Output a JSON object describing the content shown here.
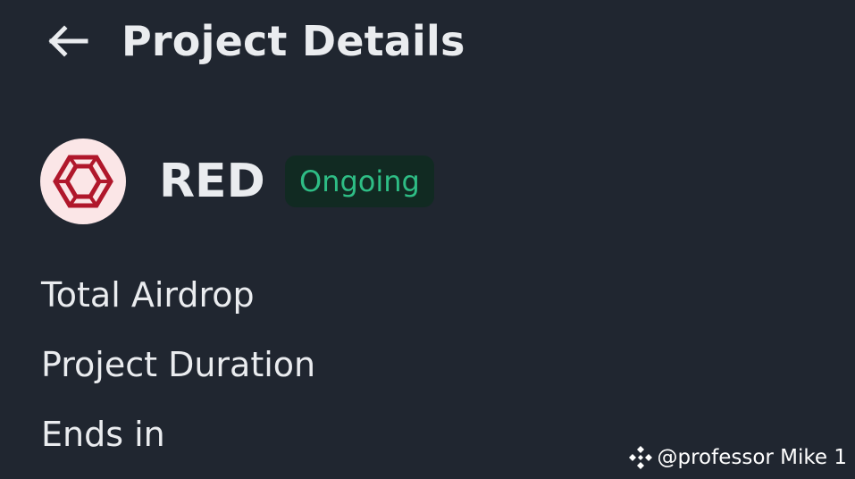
{
  "header": {
    "back_icon": "arrow-left-icon",
    "title": "Project Details"
  },
  "project": {
    "logo_icon": "hexagon-gem-icon",
    "name": "RED",
    "status": "Ongoing"
  },
  "details": {
    "labels": [
      "Total Airdrop",
      "Project Duration",
      "Ends in"
    ]
  },
  "watermark": {
    "icon": "binance-diamond-icon",
    "text": "@professor Mike 1"
  },
  "colors": {
    "background": "#202630",
    "text": "#eaecef",
    "status_green": "#2ebd85",
    "status_bg": "#112a22",
    "logo_bg": "#fbe6e7",
    "logo_red": "#b0172b"
  }
}
